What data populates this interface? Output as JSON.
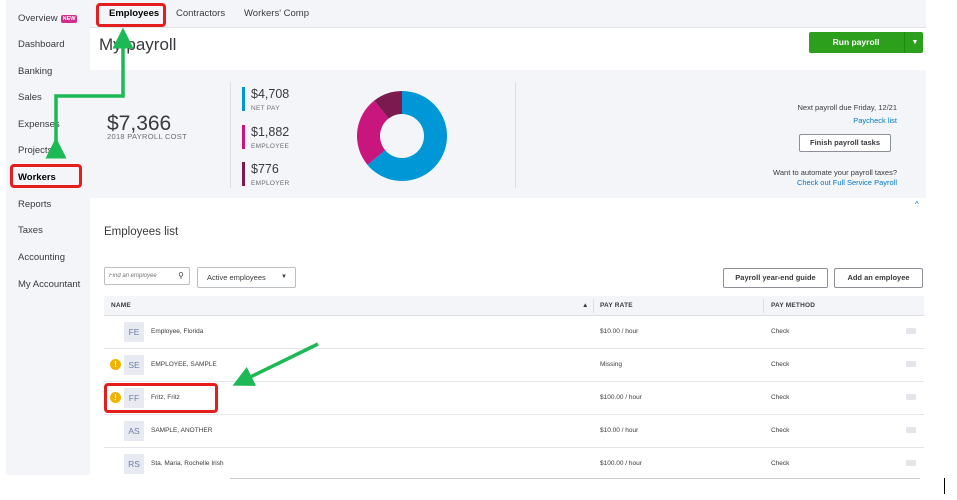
{
  "sidebar": {
    "items": [
      {
        "label": "Overview",
        "badge": "NEW"
      },
      {
        "label": "Dashboard"
      },
      {
        "label": "Banking"
      },
      {
        "label": "Sales"
      },
      {
        "label": "Expenses"
      },
      {
        "label": "Projects"
      },
      {
        "label": "Workers",
        "active": true
      },
      {
        "label": "Reports"
      },
      {
        "label": "Taxes"
      },
      {
        "label": "Accounting"
      },
      {
        "label": "My Accountant"
      }
    ]
  },
  "tabs": [
    {
      "label": "Employees",
      "active": true
    },
    {
      "label": "Contractors"
    },
    {
      "label": "Workers' Comp"
    }
  ],
  "page": {
    "title": "My payroll",
    "run_payroll_label": "Run payroll"
  },
  "summary": {
    "total_cost": "$7,366",
    "total_cost_label": "2018 PAYROLL COST",
    "breakdown": [
      {
        "value": "$4,708",
        "label": "NET PAY",
        "color": "#0097d7"
      },
      {
        "value": "$1,882",
        "label": "EMPLOYEE",
        "color": "#c9157e"
      },
      {
        "value": "$776",
        "label": "EMPLOYER",
        "color": "#7b1a4f"
      }
    ],
    "next_payroll": "Next payroll due Friday, 12/21",
    "paycheck_list_link": "Paycheck list",
    "finish_tasks_label": "Finish payroll tasks",
    "automate_question": "Want to automate your payroll taxes?",
    "full_service_link": "Check out Full Service Payroll"
  },
  "chart_data": {
    "type": "pie",
    "categories": [
      "NET PAY",
      "EMPLOYEE",
      "EMPLOYER"
    ],
    "values": [
      4708,
      1882,
      776
    ]
  },
  "employees": {
    "title": "Employees list",
    "search_placeholder": "Find an employee",
    "filter_value": "Active employees",
    "year_end_label": "Payroll year-end guide",
    "add_label": "Add an employee",
    "columns": {
      "name": "NAME",
      "pay_rate": "PAY RATE",
      "pay_method": "PAY METHOD"
    },
    "rows": [
      {
        "initials": "FE",
        "name": "Employee, Florida",
        "pay_rate": "$10.00 / hour",
        "pay_method": "Check",
        "warning": false
      },
      {
        "initials": "SE",
        "name": "EMPLOYEE, SAMPLE",
        "pay_rate": "Missing",
        "pay_method": "Check",
        "warning": true
      },
      {
        "initials": "FF",
        "name": "Fritz, Fritz",
        "pay_rate": "$100.00 / hour",
        "pay_method": "Check",
        "warning": true
      },
      {
        "initials": "AS",
        "name": "SAMPLE, ANOTHER",
        "pay_rate": "$10.00 / hour",
        "pay_method": "Check",
        "warning": false
      },
      {
        "initials": "RS",
        "name": "Sta. Maria, Rochelle Irish",
        "pay_rate": "$100.00 / hour",
        "pay_method": "Check",
        "warning": false
      }
    ]
  },
  "colors": {
    "accent_green": "#2ca01c",
    "link_blue": "#0077c5",
    "annotation_red": "#e41d1d",
    "annotation_green": "#1db954"
  }
}
